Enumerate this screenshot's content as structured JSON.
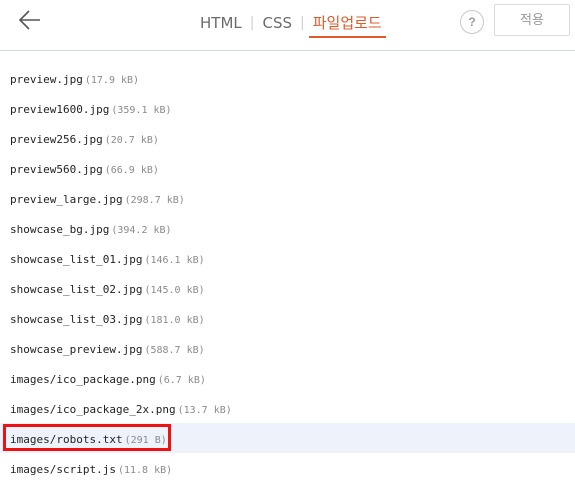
{
  "header": {
    "tabs": [
      {
        "label": "HTML",
        "active": false
      },
      {
        "label": "CSS",
        "active": false
      },
      {
        "label": "파일업로드",
        "active": true
      }
    ],
    "separator": "|",
    "help_label": "?",
    "apply_label": "적용",
    "accent_color": "#e05a2b"
  },
  "files": [
    {
      "name": "preview.jpg",
      "size": "(17.9 kB)"
    },
    {
      "name": "preview1600.jpg",
      "size": "(359.1 kB)"
    },
    {
      "name": "preview256.jpg",
      "size": "(20.7 kB)"
    },
    {
      "name": "preview560.jpg",
      "size": "(66.9 kB)"
    },
    {
      "name": "preview_large.jpg",
      "size": "(298.7 kB)"
    },
    {
      "name": "showcase_bg.jpg",
      "size": "(394.2 kB)"
    },
    {
      "name": "showcase_list_01.jpg",
      "size": "(146.1 kB)"
    },
    {
      "name": "showcase_list_02.jpg",
      "size": "(145.0 kB)"
    },
    {
      "name": "showcase_list_03.jpg",
      "size": "(181.0 kB)"
    },
    {
      "name": "showcase_preview.jpg",
      "size": "(588.7 kB)"
    },
    {
      "name": "images/ico_package.png",
      "size": "(6.7 kB)"
    },
    {
      "name": "images/ico_package_2x.png",
      "size": "(13.7 kB)"
    },
    {
      "name": "images/robots.txt",
      "size": "(291 B)"
    },
    {
      "name": "images/script.js",
      "size": "(11.8 kB)"
    }
  ],
  "highlight": {
    "row_index": 12,
    "box_color": "#ee1111"
  }
}
